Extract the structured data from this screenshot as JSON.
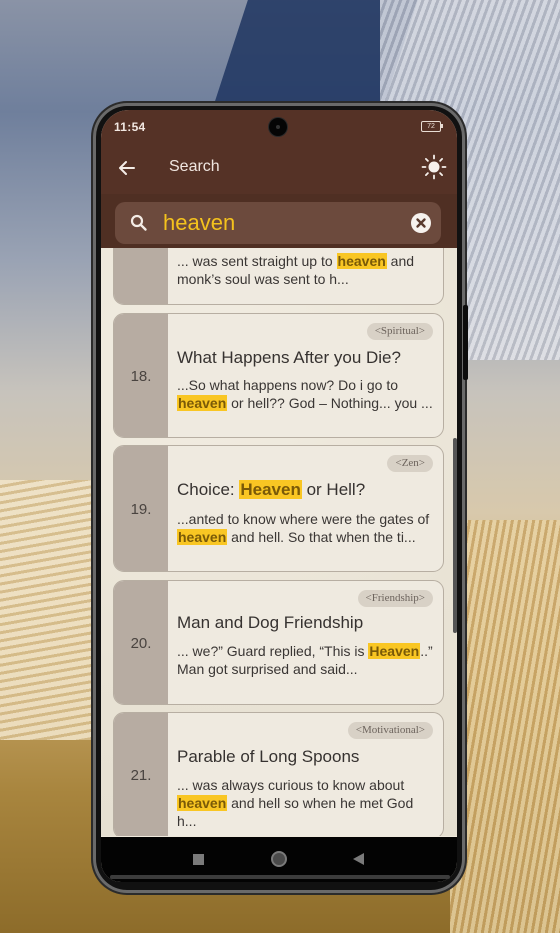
{
  "status_bar": {
    "time": "11:54",
    "battery": "72"
  },
  "app_bar": {
    "title": "Search",
    "back_icon": "arrow-left-icon",
    "theme_icon": "sun-icon"
  },
  "search": {
    "query": "heaven",
    "placeholder": "",
    "search_icon": "magnifier-icon",
    "clear_icon": "close-circle-icon"
  },
  "results": [
    {
      "number": "",
      "tag": "",
      "title": "",
      "snippet_before": "... was sent straight up to ",
      "snippet_match": "heaven",
      "snippet_after": " and monk’s soul was sent to h..."
    },
    {
      "number": "18.",
      "tag": "<Spiritual>",
      "title_before": "What Happens After you Die?",
      "title_match": "",
      "title_after": "",
      "snippet_before": "...So what happens now? Do i go to ",
      "snippet_match": "heaven",
      "snippet_after": " or hell?? God – Nothing... you ..."
    },
    {
      "number": "19.",
      "tag": "<Zen>",
      "title_before": "Choice: ",
      "title_match": "Heaven",
      "title_after": " or Hell?",
      "snippet_before": "...anted to know where were the gates of ",
      "snippet_match": "heaven",
      "snippet_after": " and hell. So that when the ti..."
    },
    {
      "number": "20.",
      "tag": "<Friendship>",
      "title_before": "Man and Dog Friendship",
      "title_match": "",
      "title_after": "",
      "snippet_before": "... we?” Guard replied, “This is ",
      "snippet_match": "Heaven",
      "snippet_after": "..” Man got surprised and said..."
    },
    {
      "number": "21.",
      "tag": "<Motivational>",
      "title_before": "Parable of Long Spoons",
      "title_match": "",
      "title_after": "",
      "snippet_before": "... was always curious to know about ",
      "snippet_match": "heaven",
      "snippet_after": " and hell so when he met God h..."
    }
  ],
  "nav_bar": {
    "recents": "square-icon",
    "home": "circle-icon",
    "back": "triangle-back-icon"
  },
  "colors": {
    "primary": "#553226",
    "highlight": "#f9c623",
    "query_text": "#f4c21d"
  }
}
